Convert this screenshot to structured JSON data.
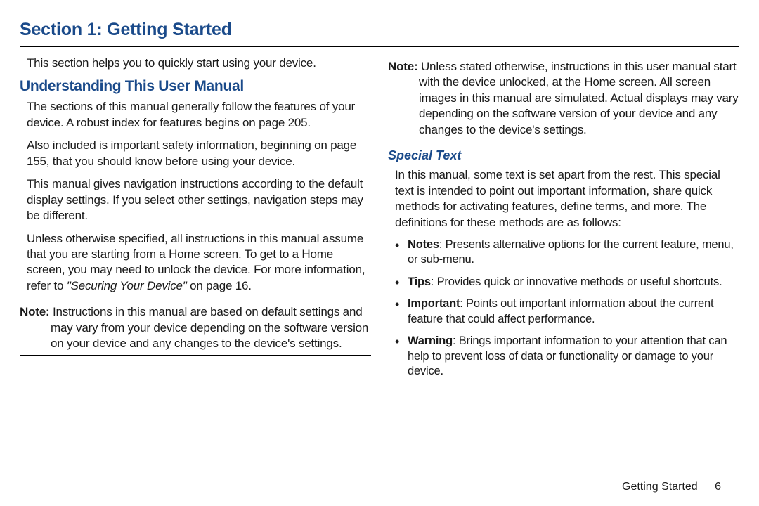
{
  "title": "Section 1: Getting Started",
  "intro": "This section helps you to quickly start using your device.",
  "h2": "Understanding This User Manual",
  "paras_left": [
    "The sections of this manual generally follow the features of your device. A robust index for features begins on page 205.",
    "Also included is important safety information, beginning on page 155, that you should know before using your device.",
    "This manual gives navigation instructions according to the default display settings. If you select other settings, navigation steps may be different."
  ],
  "para_left_ref_pre": "Unless otherwise specified, all instructions in this manual assume that you are starting from a Home screen. To get to a Home screen, you may need to unlock the device. For more information, refer to ",
  "para_left_ref_ital": "\"Securing Your Device\"",
  "para_left_ref_post": " on page 16.",
  "note1_label": "Note:",
  "note1_body": "Instructions in this manual are based on default settings and may vary from your device depending on the software version on your device and any changes to the device's settings.",
  "note2_label": "Note:",
  "note2_body": "Unless stated otherwise, instructions in this user manual start with the device unlocked, at the Home screen. All screen images in this manual are simulated. Actual displays may vary depending on the software version of your device and any changes to the device's settings.",
  "h3": "Special Text",
  "special_intro": "In this manual, some text is set apart from the rest. This special text is intended to point out important information, share quick methods for activating features, define terms, and more. The definitions for these methods are as follows:",
  "bullets": [
    {
      "label": "Notes",
      "text": ": Presents alternative options for the current feature, menu, or sub-menu."
    },
    {
      "label": "Tips",
      "text": ": Provides quick or innovative methods or useful shortcuts."
    },
    {
      "label": "Important",
      "text": ": Points out important information about the current feature that could affect performance."
    },
    {
      "label": "Warning",
      "text": ": Brings important information to your attention that can help to prevent loss of data or functionality or damage to your device."
    }
  ],
  "footer_section": "Getting Started",
  "footer_page": "6"
}
